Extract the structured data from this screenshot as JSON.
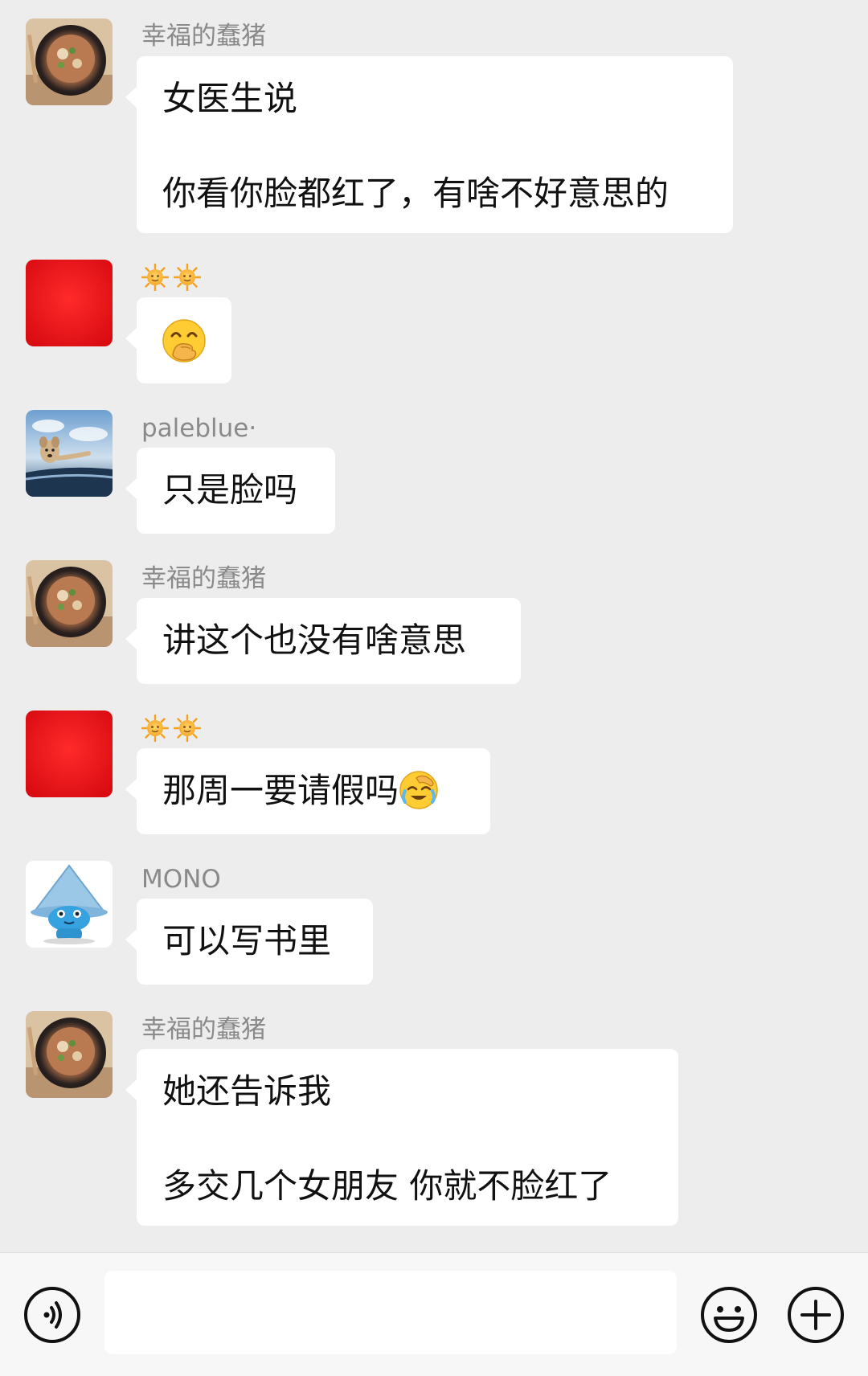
{
  "messages": [
    {
      "sender": "幸福的蠢猪",
      "avatar_icon": "food-bowl-avatar",
      "lines": [
        "女医生说",
        "",
        "你看你脸都红了，有啥不好意思的"
      ]
    },
    {
      "sender_icons": [
        "sun-emoji-icon",
        "sun-emoji-icon"
      ],
      "avatar_icon": "red-square-avatar",
      "emoji": "face-with-hand-over-mouth-icon"
    },
    {
      "sender": "paleblue·",
      "avatar_icon": "dog-in-car-avatar",
      "lines": [
        "只是脸吗"
      ]
    },
    {
      "sender": "幸福的蠢猪",
      "avatar_icon": "food-bowl-avatar",
      "lines": [
        "讲这个也没有啥意思"
      ]
    },
    {
      "sender_icons": [
        "sun-emoji-icon",
        "sun-emoji-icon"
      ],
      "avatar_icon": "red-square-avatar",
      "lines": [
        "那周一要请假吗"
      ],
      "trailing_emoji": "face-palm-crying-icon"
    },
    {
      "sender": "MONO",
      "avatar_icon": "blue-creature-hat-avatar",
      "lines": [
        "可以写书里"
      ]
    },
    {
      "sender": "幸福的蠢猪",
      "avatar_icon": "food-bowl-avatar",
      "lines": [
        "她还告诉我",
        "",
        "多交几个女朋友 你就不脸红了"
      ]
    }
  ],
  "input_bar": {
    "voice_icon": "voice-input-icon",
    "text_value": "",
    "emoji_icon": "emoji-smile-icon",
    "more_icon": "plus-circle-icon"
  },
  "colors": {
    "chat_background": "#ededed",
    "bubble": "#ffffff",
    "sender_name": "#8a8a8a",
    "red_avatar": "#e8131b"
  }
}
